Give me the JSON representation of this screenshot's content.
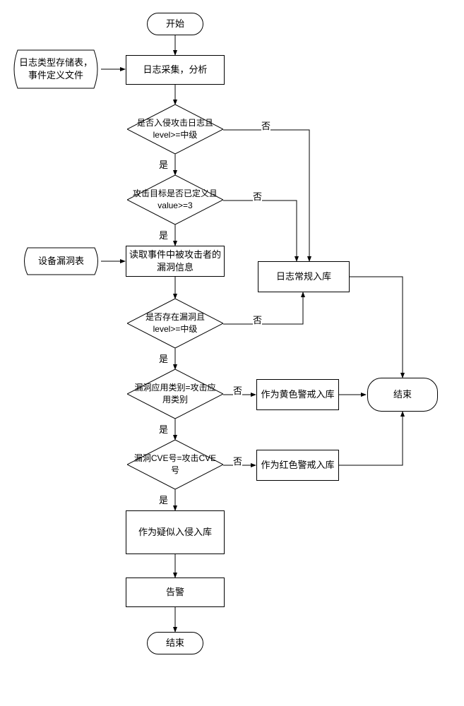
{
  "start": "开始",
  "proc_collect": "日志采集，分析",
  "storage_top": "日志类型存储表，事件定义文件",
  "d1": "是否入侵攻击日志且level>=中级",
  "d2": "攻击目标是否已定义且value>=3",
  "proc_read": "读取事件中被攻击者的漏洞信息",
  "storage_left": "设备漏洞表",
  "d3": "是否存在漏洞且level>=中级",
  "proc_normal": "日志常规入库",
  "d4": "漏洞应用类别=攻击应用类别",
  "proc_yellow": "作为黄色警戒入库",
  "d5": "漏洞CVE号=攻击CVE号",
  "proc_red": "作为红色警戒入库",
  "proc_suspect": "作为疑似入侵入库",
  "proc_alarm": "告警",
  "end1": "结束",
  "end2": "结束",
  "yes": "是",
  "no": "否",
  "chart_data": {
    "type": "flowchart",
    "nodes": [
      {
        "id": "start",
        "type": "terminator",
        "text": "开始"
      },
      {
        "id": "storage_top",
        "type": "storage",
        "text": "日志类型存储表，事件定义文件"
      },
      {
        "id": "proc_collect",
        "type": "process",
        "text": "日志采集，分析"
      },
      {
        "id": "d1",
        "type": "decision",
        "text": "是否入侵攻击日志且level>=中级"
      },
      {
        "id": "d2",
        "type": "decision",
        "text": "攻击目标是否已定义且value>=3"
      },
      {
        "id": "storage_left",
        "type": "storage",
        "text": "设备漏洞表"
      },
      {
        "id": "proc_read",
        "type": "process",
        "text": "读取事件中被攻击者的漏洞信息"
      },
      {
        "id": "proc_normal",
        "type": "process",
        "text": "日志常规入库"
      },
      {
        "id": "d3",
        "type": "decision",
        "text": "是否存在漏洞且level>=中级"
      },
      {
        "id": "d4",
        "type": "decision",
        "text": "漏洞应用类别=攻击应用类别"
      },
      {
        "id": "proc_yellow",
        "type": "process",
        "text": "作为黄色警戒入库"
      },
      {
        "id": "d5",
        "type": "decision",
        "text": "漏洞CVE号=攻击CVE号"
      },
      {
        "id": "proc_red",
        "type": "process",
        "text": "作为红色警戒入库"
      },
      {
        "id": "proc_suspect",
        "type": "process",
        "text": "作为疑似入侵入库"
      },
      {
        "id": "proc_alarm",
        "type": "process",
        "text": "告警"
      },
      {
        "id": "end1",
        "type": "terminator",
        "text": "结束"
      },
      {
        "id": "end2",
        "type": "terminator",
        "text": "结束"
      }
    ],
    "edges": [
      {
        "from": "start",
        "to": "proc_collect"
      },
      {
        "from": "storage_top",
        "to": "proc_collect"
      },
      {
        "from": "proc_collect",
        "to": "d1"
      },
      {
        "from": "d1",
        "to": "d2",
        "label": "是"
      },
      {
        "from": "d1",
        "to": "proc_normal",
        "label": "否"
      },
      {
        "from": "d2",
        "to": "proc_read",
        "label": "是"
      },
      {
        "from": "d2",
        "to": "proc_normal",
        "label": "否"
      },
      {
        "from": "storage_left",
        "to": "proc_read"
      },
      {
        "from": "proc_read",
        "to": "d3"
      },
      {
        "from": "d3",
        "to": "d4",
        "label": "是"
      },
      {
        "from": "d3",
        "to": "proc_normal",
        "label": "否"
      },
      {
        "from": "proc_normal",
        "to": "end2"
      },
      {
        "from": "d4",
        "to": "d5",
        "label": "是"
      },
      {
        "from": "d4",
        "to": "proc_yellow",
        "label": "否"
      },
      {
        "from": "proc_yellow",
        "to": "end2"
      },
      {
        "from": "d5",
        "to": "proc_suspect",
        "label": "是"
      },
      {
        "from": "d5",
        "to": "proc_red",
        "label": "否"
      },
      {
        "from": "proc_red",
        "to": "end2"
      },
      {
        "from": "proc_suspect",
        "to": "proc_alarm"
      },
      {
        "from": "proc_alarm",
        "to": "end1"
      }
    ]
  }
}
